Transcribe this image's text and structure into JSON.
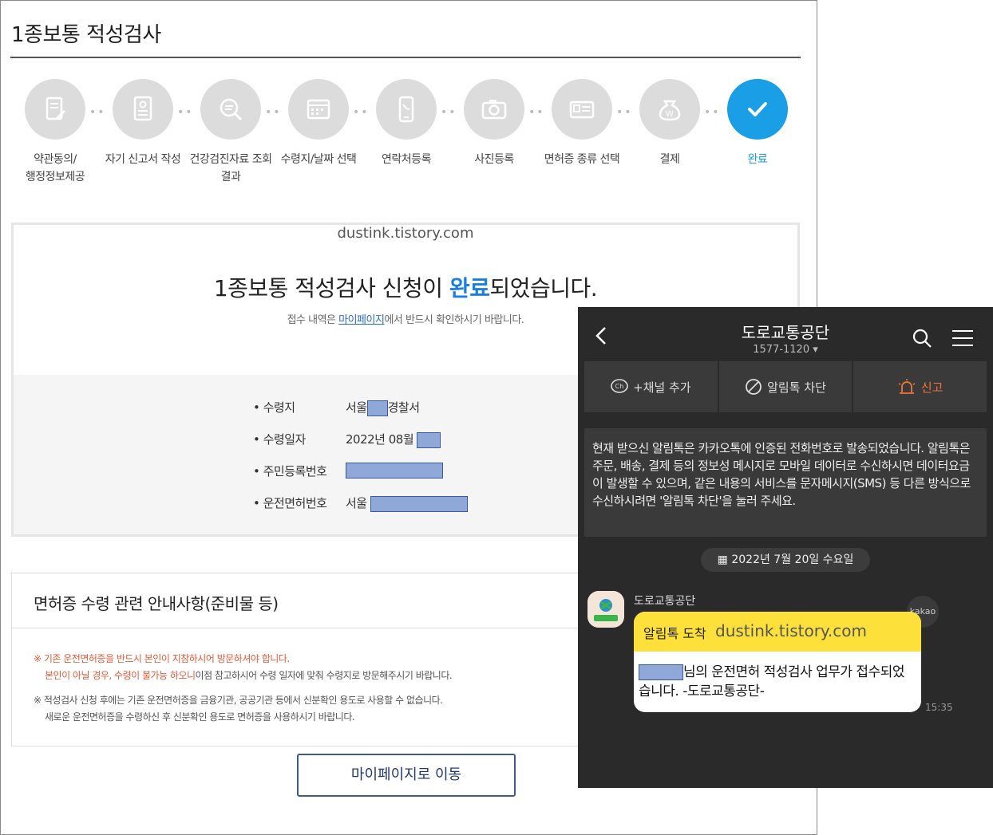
{
  "page": {
    "title": "1종보통 적성검사",
    "steps": [
      {
        "label": "약관동의/\n행정정보제공",
        "icon": "document-pen-icon",
        "active": false
      },
      {
        "label": "자기 신고서 작성",
        "icon": "id-form-icon",
        "active": false
      },
      {
        "label": "건강검진자료 조회\n결과",
        "icon": "search-document-icon",
        "active": false
      },
      {
        "label": "수령지/날짜 선택",
        "icon": "calendar-icon",
        "active": false
      },
      {
        "label": "연락처등록",
        "icon": "phone-icon",
        "active": false
      },
      {
        "label": "사진등록",
        "icon": "camera-icon",
        "active": false
      },
      {
        "label": "면허증 종류 선택",
        "icon": "license-card-icon",
        "active": false
      },
      {
        "label": "결제",
        "icon": "won-bag-icon",
        "active": false
      },
      {
        "label": "완료",
        "icon": "check-icon",
        "active": true
      }
    ],
    "watermark": "dustink.tistory.com",
    "complete_msg_before": "1종보통 적성검사 신청이 ",
    "complete_msg_highlight": "완료",
    "complete_msg_after": "되었습니다.",
    "complete_sub_before": "접수 내역은 ",
    "complete_sub_link": "마이페이지",
    "complete_sub_after": "에서 반드시 확인하시기 바랍니다.",
    "info": {
      "place_label": "• 수령지",
      "place_value_pre": "서울",
      "place_value_post": "경찰서",
      "date_label": "• 수령일자",
      "date_value": "2022년 08월 ",
      "rrn_label": "• 주민등록번호",
      "license_label": "• 운전면허번호",
      "license_value": "서울 "
    },
    "notice": {
      "title": "면허증 수령 관련 안내사항(준비물 등)",
      "line1": "※ 기존 운전면허증을 반드시 본인이 지참하시어 방문하셔야 합니다.",
      "line2_red": "본인이 아닐 경우, 수령이 불가능 하오니",
      "line2_rest": "이점 참고하시어 수령 일자에 맞춰 수령지로 방문해주시기 바랍니다.",
      "line3": "※ 적성검사 신청 후에는 기존 운전면허증을 금융기관, 공공기관 등에서 신분확인 용도로 사용할 수 없습니다.",
      "line4": "새로운 운전면허증을 수령하신 후 신분확인 용도로 면허증을 사용하시기 바랍니다."
    },
    "mypage_button": "마이페이지로 이동"
  },
  "kakao": {
    "title": "도로교통공단",
    "phone": "1577-1120 ▾",
    "add_channel": "+채널 추가",
    "block": "알림톡 차단",
    "report": "신고",
    "info_text": "현재 받으신 알림톡은 카카오톡에 인증된 전화번호로 발송되었습니다. 알림톡은 주문, 배송, 결제 등의 정보성 메시지로 모바일 데이터로 수신하시면 데이터요금이 발생할 수 있으며, 같은 내용의 서비스를 문자메시지(SMS) 등 다른 방식으로 수신하시려면 '알림톡 차단'을 눌러 주세요.",
    "date": "2022년 7월 20일 수요일",
    "sender": "도로교통공단",
    "badge": "kakao",
    "bubble_head": "알림톡 도착",
    "bubble_watermark": "dustink.tistory.com",
    "bubble_body_after": "님의 운전면허 적성검사 업무가 접수되었습니다. -도로교통공단-",
    "time": "15:35",
    "colors": {
      "bg": "#2a2a2a",
      "bubble_head": "#fde13a",
      "report": "#f0743a"
    }
  },
  "colors": {
    "accent": "#1a9ee6",
    "step_inactive": "#dcdcdc",
    "redact": "#8fa8d8"
  }
}
